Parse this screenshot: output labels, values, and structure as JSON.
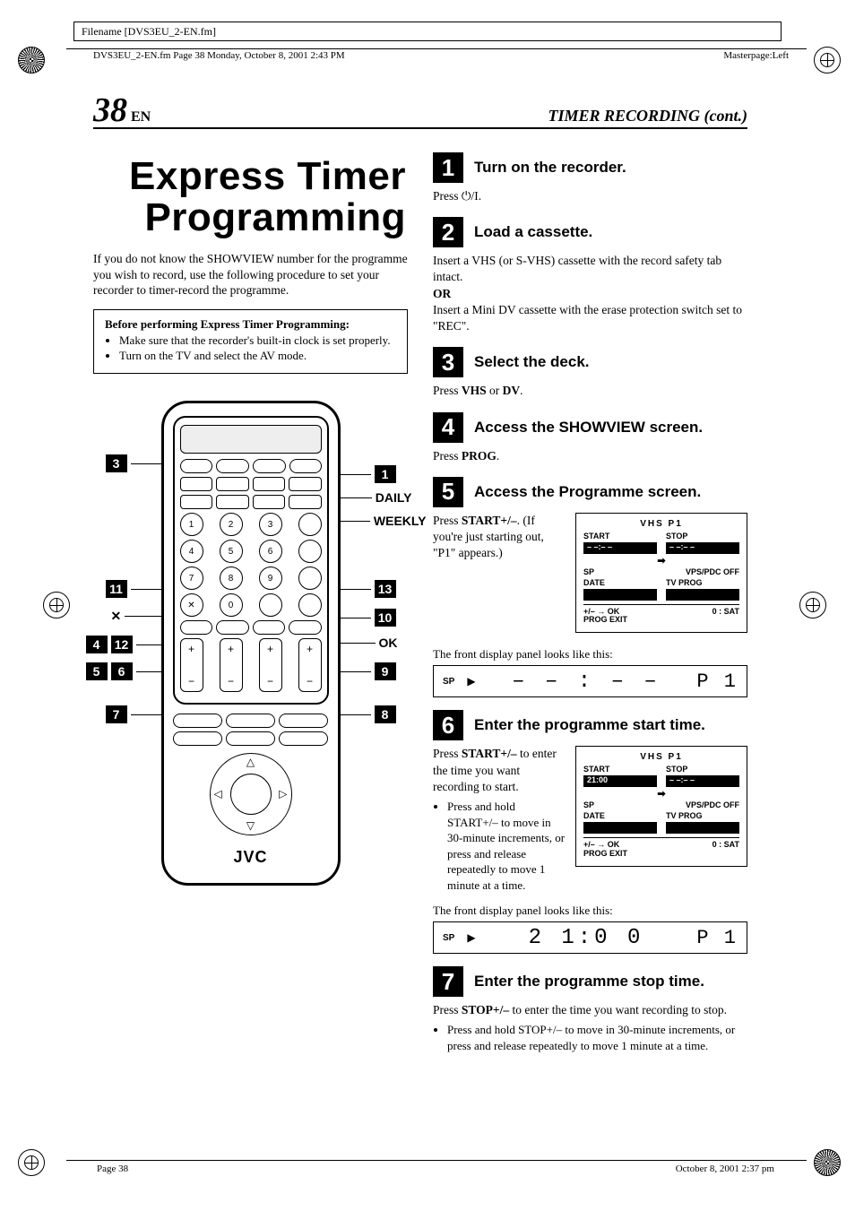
{
  "meta": {
    "filename_label": "Filename [DVS3EU_2-EN.fm]",
    "frame_left": "DVS3EU_2-EN.fm  Page 38  Monday, October 8, 2001  2:43 PM",
    "frame_right": "Masterpage:Left",
    "footer_left": "Page 38",
    "footer_right": "October 8, 2001  2:37 pm"
  },
  "header": {
    "page_num": "38",
    "lang": "EN",
    "section": "TIMER RECORDING (cont.)"
  },
  "left": {
    "title_line1": "Express Timer",
    "title_line2": "Programming",
    "intro": "If you do not know the SHOWVIEW number for the programme you wish to record, use the following procedure to set your recorder to timer-record the programme.",
    "before_title": "Before performing Express Timer Programming:",
    "before_items": [
      "Make sure that the recorder's built-in clock is set properly.",
      "Turn on the TV and select the AV mode."
    ],
    "remote_brand": "JVC",
    "callouts_right": [
      {
        "num": "1",
        "label": ""
      },
      {
        "num": "",
        "label": "DAILY"
      },
      {
        "num": "",
        "label": "WEEKLY"
      },
      {
        "num": "13",
        "label": ""
      },
      {
        "num": "10",
        "label": ""
      },
      {
        "num": "",
        "label": "OK"
      },
      {
        "num": "9",
        "label": ""
      },
      {
        "num": "8",
        "label": ""
      }
    ],
    "callouts_left": [
      {
        "num": "3",
        "label": ""
      },
      {
        "num": "11",
        "label": ""
      },
      {
        "num": "",
        "label": "✕"
      },
      {
        "num": "4",
        "label": ""
      },
      {
        "num": "12",
        "label": ""
      },
      {
        "num": "5",
        "label": ""
      },
      {
        "num": "6",
        "label": ""
      },
      {
        "num": "7",
        "label": ""
      }
    ]
  },
  "steps": [
    {
      "num": "1",
      "title": "Turn on the recorder.",
      "body": "Press ⏻/I."
    },
    {
      "num": "2",
      "title": "Load a cassette.",
      "body": "Insert a VHS (or S-VHS) cassette with the record safety tab intact.",
      "or": "OR",
      "body2": "Insert a Mini DV cassette with the erase protection switch set to \"REC\"."
    },
    {
      "num": "3",
      "title": "Select the deck.",
      "body_pre": "Press ",
      "b1": "VHS",
      "mid": " or ",
      "b2": "DV",
      "post": "."
    },
    {
      "num": "4",
      "title_pre": "Access the S",
      "title_sc": "HOW",
      "title_mid": "V",
      "title_sc2": "IEW",
      "title_post": " screen.",
      "body_pre": "Press ",
      "b1": "PROG",
      "post": "."
    },
    {
      "num": "5",
      "title": "Access the Programme screen.",
      "body_pre": "Press ",
      "b1": "START+/–",
      "body_post": ". (If you're just starting out, \"P1\" appears.)",
      "osd": {
        "top": "VHS    P1",
        "start_lbl": "START",
        "start_val": "– –:– –",
        "stop_lbl": "STOP",
        "stop_val": "– –:– –",
        "sp": "SP",
        "vps": "VPS/PDC OFF",
        "date_lbl": "DATE",
        "date_val": "",
        "tv_lbl": "TV PROG",
        "tv_val": "",
        "bottom_left": "+/–  →  OK",
        "bottom_left2": "PROG   EXIT",
        "bottom_right": "0 : SAT"
      },
      "front_caption": "The front display panel looks like this:",
      "lcd": {
        "sp": "SP",
        "digits": "– – : – –",
        "p": "P 1"
      }
    },
    {
      "num": "6",
      "title": "Enter the programme start time.",
      "body_pre": "Press ",
      "b1": "START+/–",
      "body_post": " to enter the time you want recording to start.",
      "bullets": [
        "Press and hold START+/– to move in 30-minute increments, or press and release repeatedly to move 1 minute at a time."
      ],
      "osd": {
        "top": "VHS    P1",
        "start_lbl": "START",
        "start_val": "21:00",
        "stop_lbl": "STOP",
        "stop_val": "– –:– –",
        "sp": "SP",
        "vps": "VPS/PDC OFF",
        "date_lbl": "DATE",
        "date_val": "",
        "tv_lbl": "TV PROG",
        "tv_val": "",
        "bottom_left": "+/–  →  OK",
        "bottom_left2": "PROG   EXIT",
        "bottom_right": "0 : SAT"
      },
      "front_caption": "The front display panel looks like this:",
      "lcd": {
        "sp": "SP",
        "digits": "2 1:0 0",
        "p": "P 1"
      }
    },
    {
      "num": "7",
      "title": "Enter the programme stop time.",
      "body_pre": "Press ",
      "b1": "STOP+/–",
      "body_post": " to enter the time you want recording to stop.",
      "bullets": [
        "Press and hold STOP+/– to move in 30-minute increments, or press and release repeatedly to move 1 minute at a time."
      ]
    }
  ]
}
